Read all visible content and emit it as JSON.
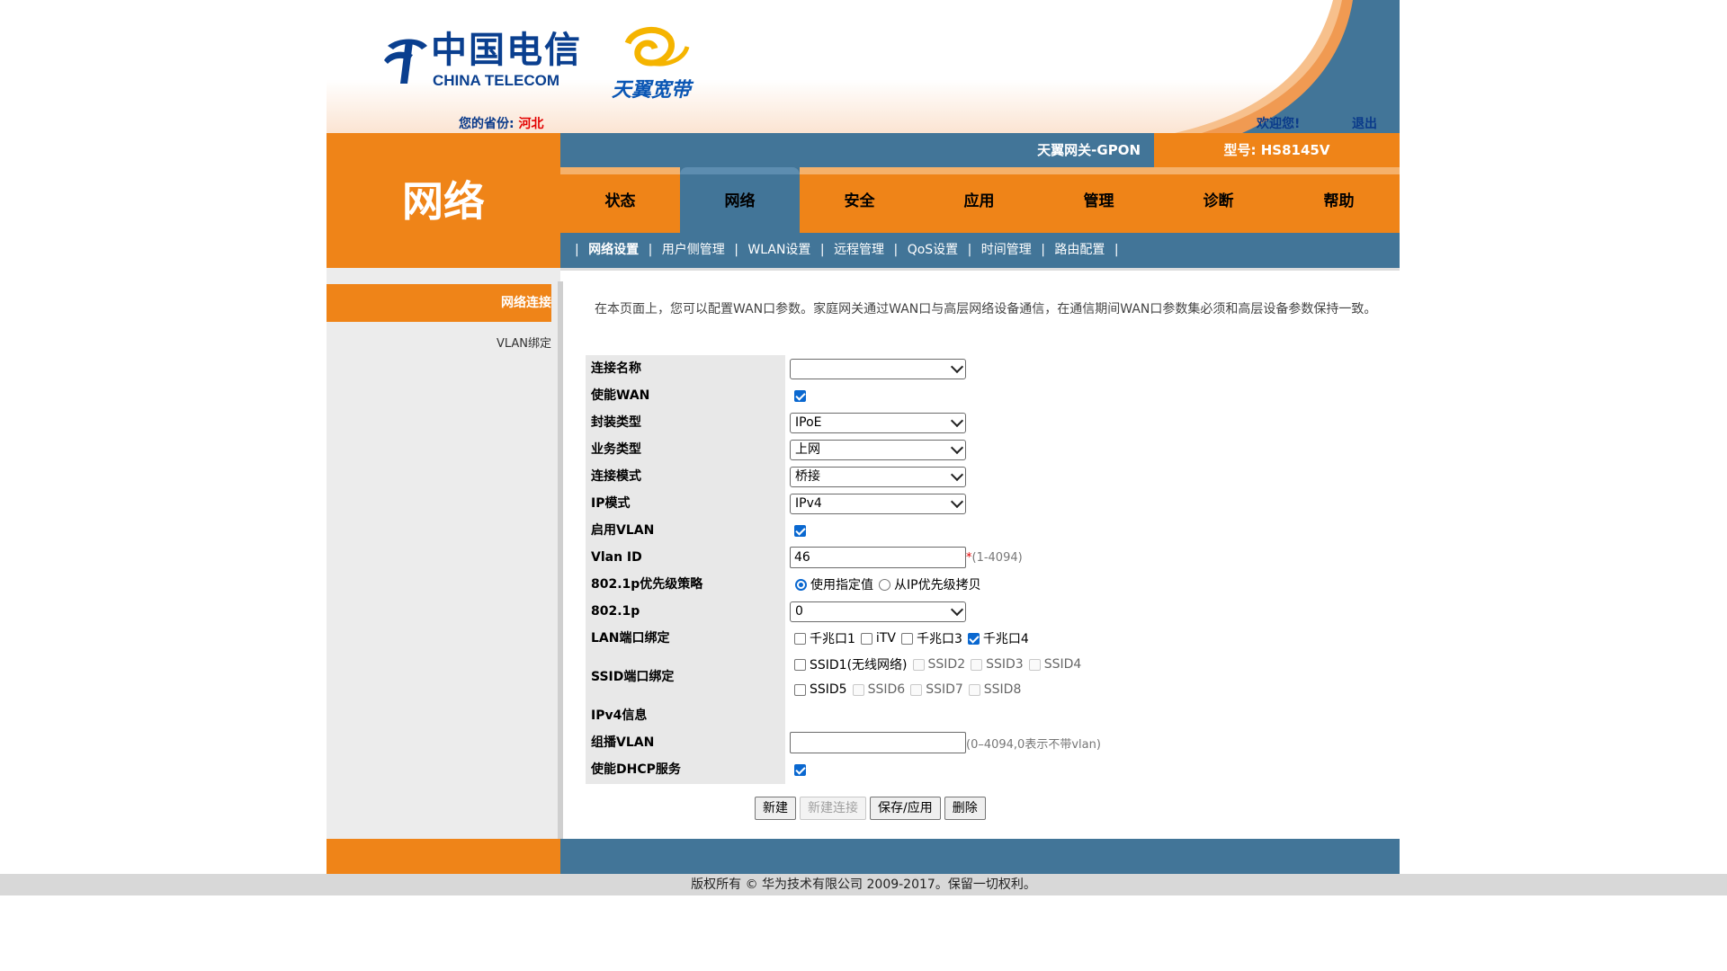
{
  "header": {
    "logo_cn": "中国电信",
    "logo_en": "CHINA TELECOM",
    "brand2": "天翼宽带",
    "province_label": "您的省份:",
    "province_value": "河北",
    "welcome": "欢迎您!",
    "logout": "退出"
  },
  "section_title": "网络",
  "info_bar": {
    "gateway": "天翼网关-GPON",
    "model": "型号: HS8145V"
  },
  "tabs": [
    "状态",
    "网络",
    "安全",
    "应用",
    "管理",
    "诊断",
    "帮助"
  ],
  "active_tab": "网络",
  "subnav": [
    "网络设置",
    "用户侧管理",
    "WLAN设置",
    "远程管理",
    "QoS设置",
    "时间管理",
    "路由配置"
  ],
  "sidenav": {
    "item1": "网络连接",
    "item2": "VLAN绑定"
  },
  "description": "在本页面上，您可以配置WAN口参数。家庭网关通过WAN口与高层网络设备通信，在通信期间WAN口参数集必须和高层设备参数保持一致。",
  "form": {
    "connection_name": {
      "label": "连接名称",
      "value": ""
    },
    "enable_wan": {
      "label": "使能WAN",
      "checked": true
    },
    "encap": {
      "label": "封装类型",
      "value": "IPoE"
    },
    "service": {
      "label": "业务类型",
      "value": "上网"
    },
    "mode": {
      "label": "连接模式",
      "value": "桥接"
    },
    "ip_mode": {
      "label": "IP模式",
      "value": "IPv4"
    },
    "enable_vlan": {
      "label": "启用VLAN",
      "checked": true
    },
    "vlan_id": {
      "label": "Vlan ID",
      "value": "46",
      "required": "*",
      "hint": "(1-4094)"
    },
    "priority_policy": {
      "label": "802.1p优先级策略",
      "opt1": "使用指定值",
      "opt2": "从IP优先级拷贝"
    },
    "p8021": {
      "label": "802.1p",
      "value": "0"
    },
    "lan_bind": {
      "label": "LAN端口绑定",
      "opts": [
        "千兆口1",
        "iTV",
        "千兆口3",
        "千兆口4"
      ]
    },
    "ssid_bind": {
      "label": "SSID端口绑定",
      "opts": [
        "SSID1(无线网络)",
        "SSID2",
        "SSID3",
        "SSID4",
        "SSID5",
        "SSID6",
        "SSID7",
        "SSID8"
      ]
    },
    "ipv4_info": {
      "label": "IPv4信息"
    },
    "multicast_vlan": {
      "label": "组播VLAN",
      "value": "",
      "hint": "(0–4094,0表示不带vlan)"
    },
    "dhcp": {
      "label": "使能DHCP服务",
      "checked": true
    }
  },
  "buttons": {
    "new": "新建",
    "new_conn": "新建连接",
    "save": "保存/应用",
    "delete": "删除"
  },
  "copyright": "版权所有 © 华为技术有限公司 2009-2017。保留一切权利。",
  "colors": {
    "orange": "#ef8418",
    "blue": "#427598",
    "check": "#0a68d0"
  }
}
